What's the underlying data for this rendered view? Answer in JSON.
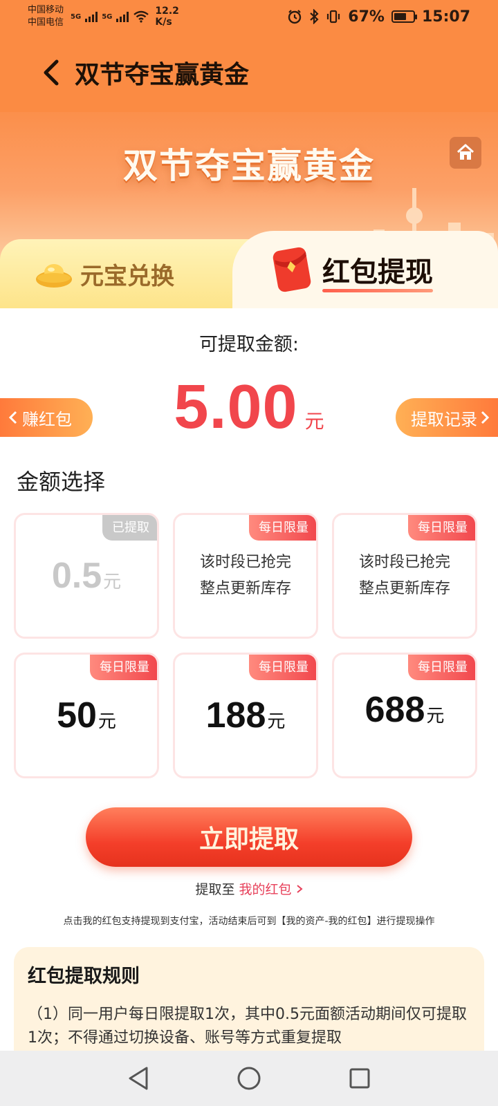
{
  "status_bar": {
    "carrier_1": "中国移动",
    "carrier_2": "中国电信",
    "net_type_1": "5G",
    "net_type_2": "5G",
    "net_speed_value": "12.2",
    "net_speed_unit": "K/s",
    "battery_percent": "67%",
    "battery_level": 0.67,
    "time": "15:07",
    "icons": [
      "alarm-icon",
      "bluetooth-icon",
      "vibrate-icon",
      "battery-icon"
    ]
  },
  "header": {
    "title": "双节夺宝赢黄金",
    "back_icon": "chevron-left-icon"
  },
  "banner": {
    "title": "双节夺宝赢黄金",
    "home_icon": "home-icon"
  },
  "tabs": [
    {
      "label": "元宝兑换",
      "icon": "gold-ingot-icon",
      "active": false
    },
    {
      "label": "红包提现",
      "icon": "red-envelope-icon",
      "active": true
    }
  ],
  "balance": {
    "label": "可提取金额:",
    "amount": "5.00",
    "unit": "元"
  },
  "side_buttons": {
    "earn": "赚红包",
    "record": "提取记录"
  },
  "amount_section": {
    "title": "金额选择",
    "options": [
      {
        "value": "0.5",
        "unit": "元",
        "tag": "已提取",
        "status": "withdrawn"
      },
      {
        "tag": "每日限量",
        "line1": "该时段已抢完",
        "line2": "整点更新库存",
        "status": "sold-out"
      },
      {
        "tag": "每日限量",
        "line1": "该时段已抢完",
        "line2": "整点更新库存",
        "status": "sold-out"
      },
      {
        "value": "50",
        "unit": "元",
        "tag": "每日限量",
        "status": "available"
      },
      {
        "value": "188",
        "unit": "元",
        "tag": "每日限量",
        "status": "available"
      },
      {
        "value": "688",
        "unit": "元",
        "tag": "每日限量",
        "status": "available"
      }
    ]
  },
  "cta": {
    "label": "立即提取"
  },
  "withdraw_to": {
    "prefix": "提取至",
    "link": "我的红包"
  },
  "note": "点击我的红包支持提现到支付宝，活动结束后可到【我的资产-我的红包】进行提现操作",
  "rules": {
    "title": "红包提取规则",
    "text": "（1）同一用户每日限提取1次，其中0.5元面额活动期间仅可提取1次；不得通过切换设备、账号等方式重复提取"
  },
  "colors": {
    "brand_orange": "#fb8b43",
    "amount_red": "#f1464c",
    "tag_red": "#f1464c",
    "link_pink": "#e7405a"
  },
  "nav": [
    "back-triangle-icon",
    "home-circle-icon",
    "recents-square-icon"
  ]
}
